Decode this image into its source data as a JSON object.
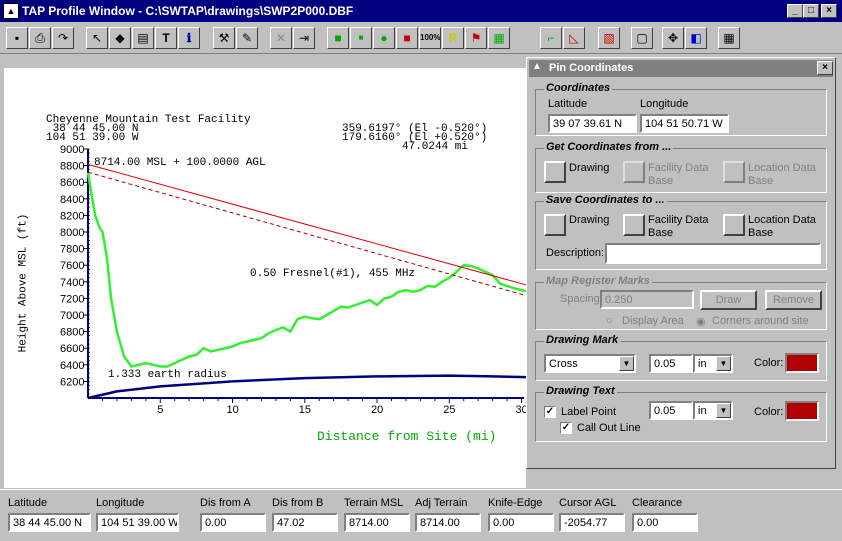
{
  "window": {
    "title": "TAP Profile Window - C:\\SWTAP\\drawings\\SWP2P000.DBF",
    "min": "_",
    "max": "□",
    "close": "×"
  },
  "toolbar": {
    "icons": [
      "save-icon",
      "print-icon",
      "redo-icon",
      "pointer-icon",
      "fill-icon",
      "clipboard-icon",
      "text-icon",
      "info-icon",
      "wrench-icon",
      "tools-icon",
      "delete-icon",
      "export-icon",
      "green-square-icon",
      "small-square-icon",
      "pin-icon",
      "red-square-icon",
      "zoom-100-icon",
      "ruler-icon",
      "flag-icon",
      "grid-icon",
      "line-chart-icon",
      "area-chart-icon",
      "hatch-icon",
      "page-icon",
      "move-icon",
      "layers-icon",
      "table-icon"
    ],
    "zoom_label": "100%"
  },
  "plot": {
    "site_name": "Cheyenne Mountain Test Facility",
    "lat": " 38 44 45.00 N",
    "lon": "104 51 39.00 W",
    "az1": "359.6197° (El -0.520°)",
    "az2": "179.6160° (El +0.520°)",
    "distance": "47.0244 mi",
    "antenna": "8714.00 MSL + 100.0000 AGL",
    "fresnel": "0.50 Fresnel(#1), 455 MHz",
    "earth": "1.333 earth radius",
    "ylabel": "Height Above MSL (ft)",
    "xlabel": "Distance from Site (mi)"
  },
  "chart_data": {
    "type": "line",
    "xlabel": "Distance from Site (mi)",
    "ylabel": "Height Above MSL (ft)",
    "ylim": [
      6000,
      9000
    ],
    "xlim": [
      0,
      31
    ],
    "yticks": [
      9000,
      8800,
      8600,
      8400,
      8200,
      8000,
      7800,
      7600,
      7400,
      7200,
      7000,
      6800,
      6600,
      6400,
      6200
    ],
    "xticks": [
      5,
      10,
      15,
      20,
      25,
      30
    ],
    "series": [
      {
        "color": "#33ee33",
        "x": [
          0,
          0.2,
          0.5,
          0.8,
          1,
          1.3,
          1.6,
          2,
          2.5,
          3,
          3.5,
          4,
          4.5,
          5,
          5.5,
          6,
          6.5,
          7,
          7.5,
          8,
          8.5,
          9,
          9.5,
          10,
          10.5,
          11,
          11.5,
          12,
          12.5,
          13,
          13.5,
          14,
          14.5,
          15,
          15.5,
          16,
          16.5,
          17,
          17.5,
          18,
          18.5,
          19,
          19.5,
          20,
          20.5,
          21,
          21.5,
          22,
          22.5,
          23,
          23.5,
          24,
          24.5,
          25,
          25.5,
          26,
          26.5,
          27,
          27.5,
          28,
          28.5,
          29,
          29.5,
          30,
          30.5,
          31
        ],
        "values": [
          8714,
          8500,
          8200,
          8050,
          8000,
          7700,
          7200,
          6800,
          6500,
          6380,
          6400,
          6420,
          6400,
          6380,
          6380,
          6420,
          6460,
          6500,
          6520,
          6600,
          6560,
          6580,
          6600,
          6620,
          6660,
          6680,
          6700,
          6720,
          6780,
          6820,
          6850,
          6800,
          6950,
          6980,
          6960,
          6950,
          7000,
          7050,
          7100,
          7090,
          7120,
          7150,
          7180,
          7120,
          7200,
          7220,
          7280,
          7300,
          7280,
          7300,
          7350,
          7340,
          7400,
          7450,
          7520,
          7600,
          7590,
          7560,
          7520,
          7480,
          7380,
          7350,
          7320,
          7300,
          7280,
          7200
        ]
      },
      {
        "color": "#e00000",
        "x": [
          0,
          31
        ],
        "values": [
          8814,
          7330
        ]
      },
      {
        "color": "#a00000",
        "dashed": true,
        "x": [
          0,
          31
        ],
        "values": [
          8720,
          7200
        ]
      },
      {
        "color": "#000080",
        "x": [
          0,
          2,
          5,
          10,
          15,
          20,
          25,
          28,
          31
        ],
        "values": [
          6000,
          6080,
          6140,
          6200,
          6240,
          6260,
          6270,
          6260,
          6250
        ]
      }
    ]
  },
  "pin_panel": {
    "title": "Pin Coordinates",
    "coords": {
      "title": "Coordinates",
      "lat_label": "Latitude",
      "lon_label": "Longitude",
      "lat": "39 07 39.61 N",
      "lon": "104 51 50.71 W"
    },
    "get": {
      "title": "Get Coordinates from ...",
      "drawing": "Drawing",
      "facility": "Facility Data Base",
      "location": "Location Data Base"
    },
    "save": {
      "title": "Save Coordinates to ...",
      "drawing": "Drawing",
      "facility": "Facility Data Base",
      "location": "Location Data Base",
      "desc_label": "Description:",
      "desc": ""
    },
    "register": {
      "title": "Map Register Marks",
      "spacing_label": "Spacing:",
      "spacing": "0.250",
      "draw": "Draw",
      "remove": "Remove",
      "opt1": "Display Area",
      "opt2": "Corners around site"
    },
    "mark": {
      "title": "Drawing Mark",
      "type": "Cross",
      "size": "0.05",
      "unit": "in",
      "color_label": "Color:"
    },
    "text": {
      "title": "Drawing Text",
      "label_point": "Label Point",
      "callout": "Call Out Line",
      "size": "0.05",
      "unit": "in",
      "color_label": "Color:"
    }
  },
  "status": {
    "fields": [
      {
        "label": "Latitude",
        "value": "38 44 45.00 N"
      },
      {
        "label": "Longitude",
        "value": "104 51 39.00 W"
      },
      {
        "label": "Dis from A",
        "value": "0.00"
      },
      {
        "label": "Dis from B",
        "value": "47.02"
      },
      {
        "label": "Terrain MSL",
        "value": "8714.00"
      },
      {
        "label": "Adj Terrain",
        "value": "8714.00"
      },
      {
        "label": "Knife-Edge",
        "value": "0.00"
      },
      {
        "label": "Cursor AGL",
        "value": "-2054.77"
      },
      {
        "label": "Clearance",
        "value": "0.00"
      }
    ]
  }
}
